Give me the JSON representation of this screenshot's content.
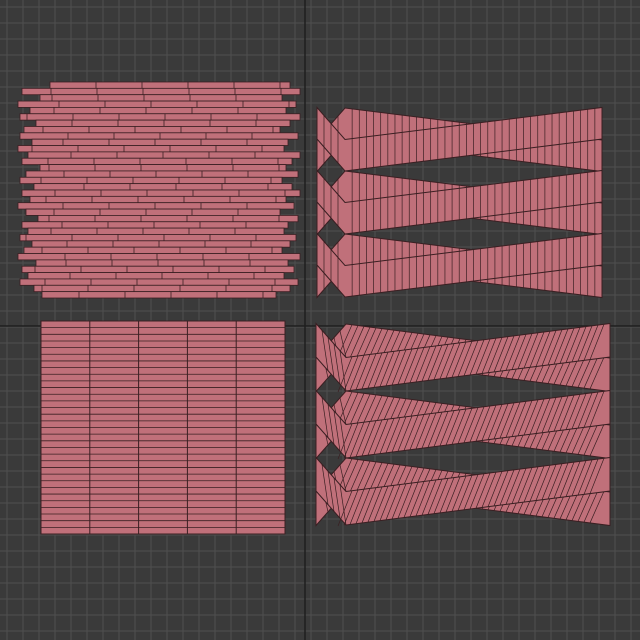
{
  "viewport": {
    "background": "#3a3a3a",
    "grid_color": "#505050",
    "axis_color": "#1e1e1e",
    "grid_visible": true
  },
  "material": {
    "fill": "#c0707a",
    "stroke": "#3a1f22"
  },
  "patterns": [
    {
      "id": "staggered-plank",
      "rows": 34
    },
    {
      "id": "herringbone",
      "bands": 6,
      "planks_per_band": 36
    },
    {
      "id": "parallel-plank-columns",
      "columns": 5,
      "rows": 32
    },
    {
      "id": "chevron",
      "bands": 6,
      "planks_per_band": 44
    }
  ]
}
